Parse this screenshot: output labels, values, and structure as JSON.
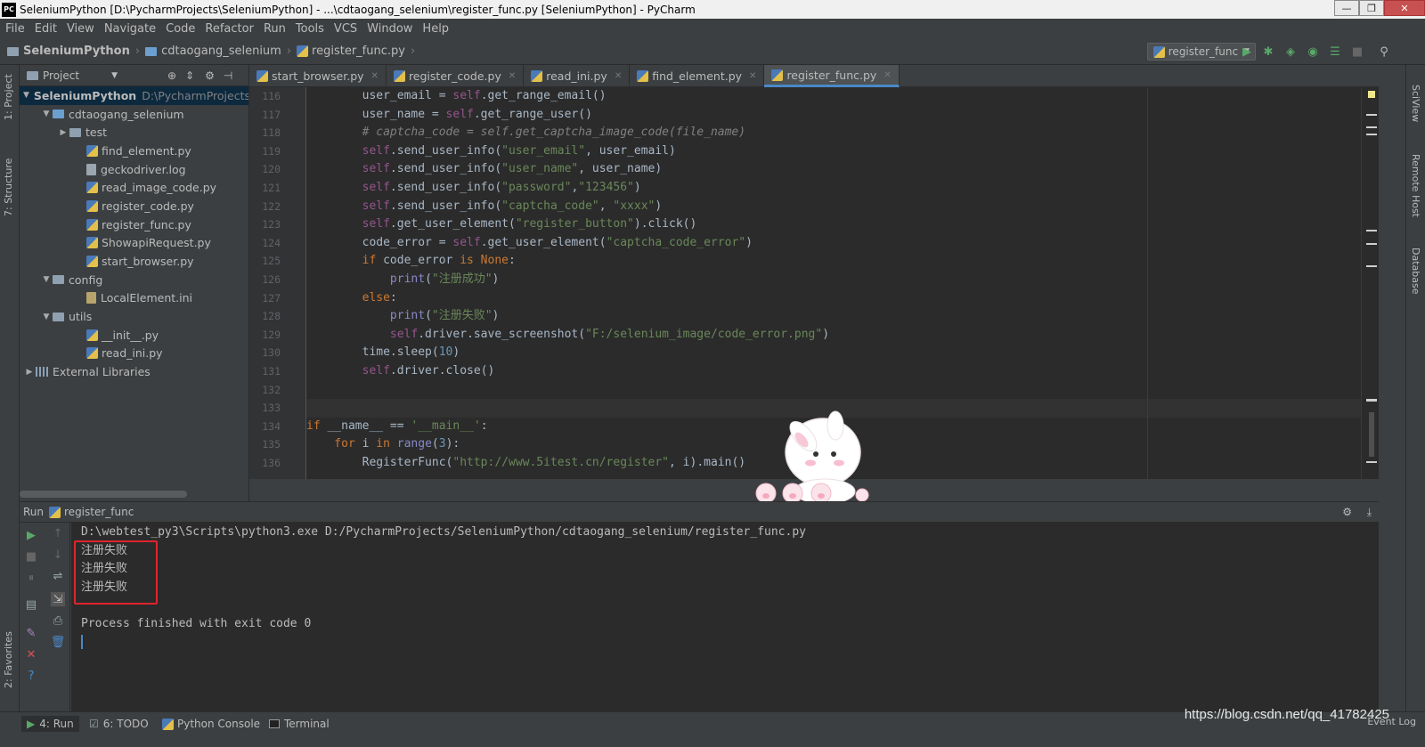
{
  "window": {
    "title": "SeleniumPython [D:\\PycharmProjects\\SeleniumPython] - ...\\cdtaogang_selenium\\register_func.py [SeleniumPython] - PyCharm",
    "logo": "PC",
    "min": "—",
    "max": "❐",
    "close": "✕"
  },
  "menu": [
    "File",
    "Edit",
    "View",
    "Navigate",
    "Code",
    "Refactor",
    "Run",
    "Tools",
    "VCS",
    "Window",
    "Help"
  ],
  "breadcrumbs": [
    "SeleniumPython",
    "cdtaogang_selenium",
    "register_func.py"
  ],
  "run_config": {
    "label": "register_func",
    "arrow": "▼"
  },
  "left_stripe": {
    "project": "1: Project",
    "structure": "7: Structure",
    "favorites": "2: Favorites"
  },
  "right_stripe": {
    "sciview": "SciView",
    "remote": "Remote Host",
    "database": "Database"
  },
  "project_panel": {
    "header": "Project",
    "tree": [
      {
        "label": "SeleniumPython",
        "hint": "D:\\PycharmProjects\\",
        "indent": 0,
        "arrow": "▼",
        "icon": "folder",
        "selected": true,
        "bold": true
      },
      {
        "label": "cdtaogang_selenium",
        "indent": 1,
        "arrow": "▼",
        "icon": "folder-blue"
      },
      {
        "label": "test",
        "indent": 2,
        "arrow": "▶",
        "icon": "folder"
      },
      {
        "label": "find_element.py",
        "indent": 3,
        "icon": "python-file"
      },
      {
        "label": "geckodriver.log",
        "indent": 3,
        "icon": "text-file"
      },
      {
        "label": "read_image_code.py",
        "indent": 3,
        "icon": "python-file"
      },
      {
        "label": "register_code.py",
        "indent": 3,
        "icon": "python-file"
      },
      {
        "label": "register_func.py",
        "indent": 3,
        "icon": "python-file"
      },
      {
        "label": "ShowapiRequest.py",
        "indent": 3,
        "icon": "python-file"
      },
      {
        "label": "start_browser.py",
        "indent": 3,
        "icon": "python-file"
      },
      {
        "label": "config",
        "indent": 1,
        "arrow": "▼",
        "icon": "folder"
      },
      {
        "label": "LocalElement.ini",
        "indent": 3,
        "icon": "ini-file"
      },
      {
        "label": "utils",
        "indent": 1,
        "arrow": "▼",
        "icon": "folder"
      },
      {
        "label": "__init__.py",
        "indent": 3,
        "icon": "python-file"
      },
      {
        "label": "read_ini.py",
        "indent": 3,
        "icon": "python-file"
      },
      {
        "label": "External Libraries",
        "indent": 0,
        "arrow": "▶",
        "icon": "library"
      }
    ]
  },
  "tabs": [
    {
      "label": "start_browser.py",
      "active": false
    },
    {
      "label": "register_code.py",
      "active": false
    },
    {
      "label": "read_ini.py",
      "active": false
    },
    {
      "label": "find_element.py",
      "active": false
    },
    {
      "label": "register_func.py",
      "active": true
    }
  ],
  "editor": {
    "lines": [
      {
        "n": "116",
        "tokens": [
          [
            "",
            "        user_email = "
          ],
          [
            "self",
            "self"
          ],
          [
            "",
            ".get_range_email()"
          ]
        ]
      },
      {
        "n": "117",
        "tokens": [
          [
            "",
            "        user_name = "
          ],
          [
            "self",
            "self"
          ],
          [
            "",
            ".get_range_user()"
          ]
        ]
      },
      {
        "n": "118",
        "tokens": [
          [
            "cmt",
            "        # captcha_code = self.get_captcha_image_code(file_name)"
          ]
        ]
      },
      {
        "n": "119",
        "tokens": [
          [
            "self",
            "        self"
          ],
          [
            "",
            ".send_user_info("
          ],
          [
            "str",
            "\"user_email\""
          ],
          [
            "",
            ", user_email)"
          ]
        ]
      },
      {
        "n": "120",
        "tokens": [
          [
            "self",
            "        self"
          ],
          [
            "",
            ".send_user_info("
          ],
          [
            "str",
            "\"user_name\""
          ],
          [
            "",
            ", user_name)"
          ]
        ]
      },
      {
        "n": "121",
        "tokens": [
          [
            "self",
            "        self"
          ],
          [
            "",
            ".send_user_info("
          ],
          [
            "str",
            "\"password\""
          ],
          [
            "",
            ","
          ],
          [
            "str",
            "\"123456\""
          ],
          [
            "",
            ")"
          ]
        ]
      },
      {
        "n": "122",
        "tokens": [
          [
            "self",
            "        self"
          ],
          [
            "",
            ".send_user_info("
          ],
          [
            "str",
            "\"captcha_code\""
          ],
          [
            "",
            ", "
          ],
          [
            "str",
            "\"xxxx\""
          ],
          [
            "",
            ")"
          ]
        ]
      },
      {
        "n": "123",
        "tokens": [
          [
            "self",
            "        self"
          ],
          [
            "",
            ".get_user_element("
          ],
          [
            "str",
            "\"register_button\""
          ],
          [
            "",
            ").click()"
          ]
        ]
      },
      {
        "n": "124",
        "tokens": [
          [
            "",
            "        code_error = "
          ],
          [
            "self",
            "self"
          ],
          [
            "",
            ".get_user_element("
          ],
          [
            "str",
            "\"captcha_code_error\""
          ],
          [
            "",
            ")"
          ]
        ]
      },
      {
        "n": "125",
        "tokens": [
          [
            "kw",
            "        if "
          ],
          [
            "",
            "code_error "
          ],
          [
            "kw",
            "is "
          ],
          [
            "kw",
            "None"
          ],
          [
            "",
            ":"
          ]
        ]
      },
      {
        "n": "126",
        "tokens": [
          [
            "bi",
            "            print"
          ],
          [
            "",
            "("
          ],
          [
            "str",
            "\"注册成功\""
          ],
          [
            "",
            ")"
          ]
        ]
      },
      {
        "n": "127",
        "tokens": [
          [
            "kw",
            "        else"
          ],
          [
            "",
            ":"
          ]
        ]
      },
      {
        "n": "128",
        "tokens": [
          [
            "bi",
            "            print"
          ],
          [
            "",
            "("
          ],
          [
            "str",
            "\"注册失败\""
          ],
          [
            "",
            ")"
          ]
        ]
      },
      {
        "n": "129",
        "tokens": [
          [
            "self",
            "            self"
          ],
          [
            "",
            ".driver.save_screenshot("
          ],
          [
            "str",
            "\"F:/selenium_image/code_error.png\""
          ],
          [
            "",
            ")"
          ]
        ]
      },
      {
        "n": "130",
        "tokens": [
          [
            "",
            "        time.sleep("
          ],
          [
            "num",
            "10"
          ],
          [
            "",
            ")"
          ]
        ]
      },
      {
        "n": "131",
        "tokens": [
          [
            "self",
            "        self"
          ],
          [
            "",
            ".driver.close()"
          ]
        ]
      },
      {
        "n": "132",
        "tokens": [
          [
            "",
            ""
          ]
        ]
      },
      {
        "n": "133",
        "tokens": [
          [
            "",
            ""
          ]
        ]
      },
      {
        "n": "134",
        "tokens": [
          [
            "kw",
            "if "
          ],
          [
            "",
            "__name__ == "
          ],
          [
            "str",
            "'__main__'"
          ],
          [
            "",
            ":"
          ]
        ]
      },
      {
        "n": "135",
        "tokens": [
          [
            "kw",
            "    for "
          ],
          [
            "",
            "i "
          ],
          [
            "kw",
            "in "
          ],
          [
            "bi",
            "range"
          ],
          [
            "",
            "("
          ],
          [
            "num",
            "3"
          ],
          [
            "",
            "):"
          ]
        ]
      },
      {
        "n": "136",
        "tokens": [
          [
            "",
            "        RegisterFunc("
          ],
          [
            "str",
            "\"http://www.5itest.cn/register\""
          ],
          [
            "",
            ", i).main()"
          ]
        ]
      }
    ]
  },
  "run_panel": {
    "label": "Run",
    "config": "register_func",
    "output": [
      "D:\\webtest_py3\\Scripts\\python3.exe D:/PycharmProjects/SeleniumPython/cdtaogang_selenium/register_func.py",
      "注册失败",
      "注册失败",
      "注册失败",
      "",
      "Process finished with exit code 0"
    ]
  },
  "bottom_tabs": [
    "4: Run",
    "6: TODO",
    "Python Console",
    "Terminal"
  ],
  "watermark": "https://blog.csdn.net/qq_41782425",
  "event_log": "Event Log",
  "colors": {
    "accent": "#4a88c7",
    "highlight_box": "#e0242b",
    "run_green": "#59a869"
  }
}
